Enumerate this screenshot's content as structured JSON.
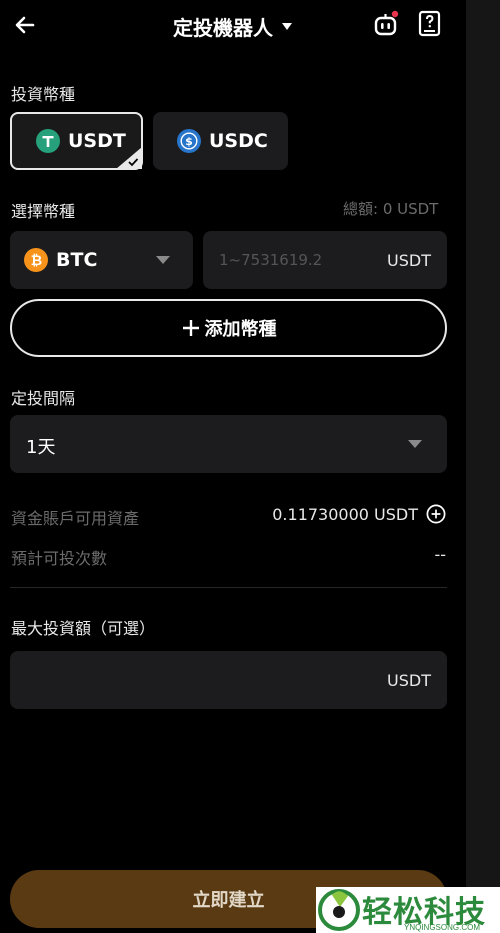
{
  "header": {
    "title": "定投機器人"
  },
  "invest_coin": {
    "label": "投資幣種",
    "options": [
      {
        "name": "USDT",
        "selected": true
      },
      {
        "name": "USDC",
        "selected": false
      }
    ]
  },
  "select_coin": {
    "label": "選擇幣種",
    "total": "總額: 0 USDT",
    "coin": "BTC",
    "amount_placeholder": "1~7531619.2",
    "amount_unit": "USDT"
  },
  "add_coin": {
    "label": "添加幣種"
  },
  "interval": {
    "label": "定投間隔",
    "value": "1天"
  },
  "available": {
    "label": "資金賬戶可用資產",
    "value": "0.11730000 USDT"
  },
  "estimated": {
    "label": "預計可投次數",
    "value": "--"
  },
  "max_invest": {
    "label": "最大投資額（可選）",
    "unit": "USDT"
  },
  "create_button": {
    "label": "立即建立"
  },
  "watermark": {
    "text": "轻松科技",
    "sub": "YNQINGSONG.COM"
  },
  "colors": {
    "usdt": "#26a17b",
    "usdc": "#2775ca",
    "btc": "#f7931a",
    "primary_button": "#5a3a12"
  }
}
